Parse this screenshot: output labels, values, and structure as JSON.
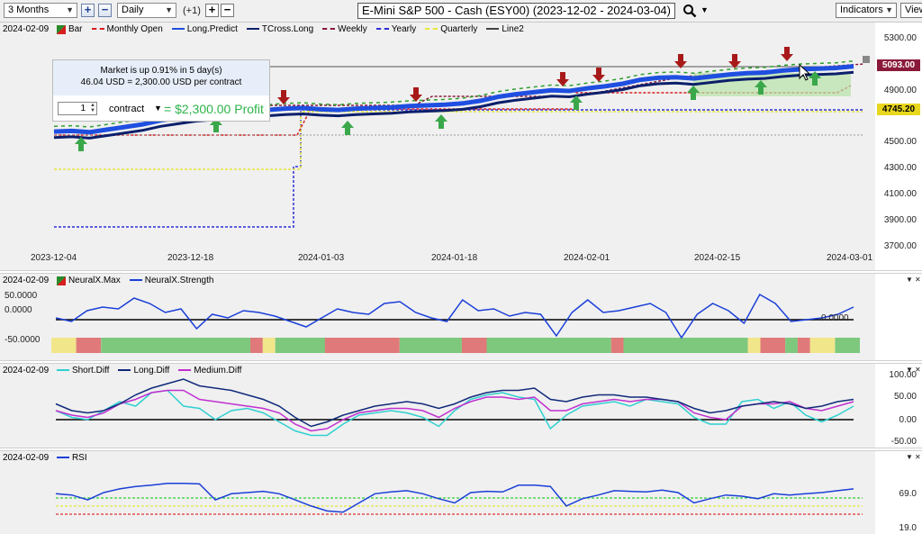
{
  "toolbar": {
    "range_value": "3 Months",
    "interval_value": "Daily",
    "offset_label": "(+1)",
    "title": "E-Mini S&P 500 - Cash (ESY00) (2023-12-02 - 2024-03-04)",
    "indicators_label": "Indicators",
    "view_label": "View"
  },
  "main": {
    "date": "2024-02-09",
    "legend": [
      {
        "label": "Bar",
        "color": "#2a8a2a",
        "style": "bar"
      },
      {
        "label": "Monthly Open",
        "color": "#d81e1e",
        "style": "dash"
      },
      {
        "label": "Long.Predict",
        "color": "#1f4fe0",
        "style": "line"
      },
      {
        "label": "TCross.Long",
        "color": "#0b1f6b",
        "style": "line"
      },
      {
        "label": "Weekly",
        "color": "#8a1a3a",
        "style": "dash"
      },
      {
        "label": "Yearly",
        "color": "#2f2fd8",
        "style": "dash"
      },
      {
        "label": "Quarterly",
        "color": "#e6e63a",
        "style": "dash"
      },
      {
        "label": "Line2",
        "color": "#444444",
        "style": "line"
      }
    ],
    "info": {
      "line1": "Market is up 0.91% in 5 day(s)",
      "line2": "46.04 USD = 2,300.00 USD per contract",
      "qty": "1",
      "contract_label": "contract",
      "profit": "= $2,300.00 Profit"
    },
    "y_ticks": [
      "5300.00",
      "4900.00",
      "4500.00",
      "4300.00",
      "4100.00",
      "3900.00",
      "3700.00"
    ],
    "badges": [
      {
        "text": "5093.00",
        "color": "#8a1a3a"
      },
      {
        "text": "4745.20",
        "color": "#e8d71e"
      }
    ],
    "x_ticks": [
      "2023-12-04",
      "2023-12-18",
      "2024-01-03",
      "2024-01-18",
      "2024-02-01",
      "2024-02-15",
      "2024-03-01"
    ],
    "price": [
      4595,
      4600,
      4590,
      4610,
      4630,
      4650,
      4680,
      4700,
      4720,
      4730,
      4740,
      4755,
      4760,
      4770,
      4775,
      4765,
      4760,
      4770,
      4775,
      4780,
      4790,
      4795,
      4800,
      4810,
      4830,
      4860,
      4880,
      4895,
      4910,
      4905,
      4925,
      4940,
      4960,
      4990,
      5005,
      5010,
      5000,
      5015,
      5030,
      5040,
      5045,
      5060,
      5070,
      5075,
      5080,
      5093
    ]
  },
  "panel_neural": {
    "date": "2024-02-09",
    "legend": [
      {
        "label": "NeuralX.Max",
        "color": "#2a8a2a",
        "style": "bar"
      },
      {
        "label": "NeuralX.Strength",
        "color": "#1a3fd8",
        "style": "line"
      }
    ],
    "y_ticks": [
      "50.0000",
      "0.0000",
      "-50.0000"
    ],
    "strength": [
      5,
      -5,
      25,
      35,
      30,
      60,
      45,
      20,
      30,
      -25,
      15,
      5,
      25,
      20,
      10,
      -5,
      -20,
      5,
      30,
      20,
      15,
      45,
      50,
      20,
      5,
      -5,
      55,
      25,
      30,
      10,
      20,
      15,
      -45,
      20,
      55,
      20,
      25,
      35,
      45,
      20,
      -50,
      15,
      45,
      25,
      -10,
      70,
      45,
      -5,
      0,
      5,
      15,
      35
    ],
    "segments": [
      {
        "w": 2,
        "c": "#f2e68a"
      },
      {
        "w": 2,
        "c": "#e07a7a"
      },
      {
        "w": 12,
        "c": "#7ec87e"
      },
      {
        "w": 1,
        "c": "#e07a7a"
      },
      {
        "w": 1,
        "c": "#f2e68a"
      },
      {
        "w": 4,
        "c": "#7ec87e"
      },
      {
        "w": 6,
        "c": "#e07a7a"
      },
      {
        "w": 5,
        "c": "#7ec87e"
      },
      {
        "w": 2,
        "c": "#e07a7a"
      },
      {
        "w": 10,
        "c": "#7ec87e"
      },
      {
        "w": 1,
        "c": "#e07a7a"
      },
      {
        "w": 10,
        "c": "#7ec87e"
      },
      {
        "w": 1,
        "c": "#f2e68a"
      },
      {
        "w": 2,
        "c": "#e07a7a"
      },
      {
        "w": 1,
        "c": "#7ec87e"
      },
      {
        "w": 1,
        "c": "#e07a7a"
      },
      {
        "w": 2,
        "c": "#f2e68a"
      },
      {
        "w": 2,
        "c": "#7ec87e"
      }
    ]
  },
  "panel_diff": {
    "date": "2024-02-09",
    "legend": [
      {
        "label": "Short.Diff",
        "color": "#30d0d0",
        "style": "line"
      },
      {
        "label": "Long.Diff",
        "color": "#102a7a",
        "style": "line"
      },
      {
        "label": "Medium.Diff",
        "color": "#c030d0",
        "style": "line"
      }
    ],
    "y_ticks": [
      "100.00",
      "50.00",
      "0.00",
      "-50.00"
    ],
    "short": [
      20,
      5,
      0,
      20,
      40,
      30,
      60,
      65,
      30,
      25,
      0,
      20,
      25,
      15,
      -5,
      -25,
      -35,
      -35,
      -10,
      10,
      15,
      20,
      15,
      5,
      -15,
      20,
      45,
      55,
      60,
      50,
      45,
      -20,
      10,
      30,
      35,
      40,
      30,
      45,
      40,
      35,
      5,
      -10,
      -10,
      40,
      45,
      25,
      40,
      10,
      -5,
      10,
      30
    ],
    "long": [
      35,
      20,
      15,
      20,
      35,
      55,
      70,
      80,
      90,
      75,
      70,
      65,
      55,
      45,
      30,
      5,
      -15,
      -5,
      10,
      20,
      30,
      35,
      40,
      35,
      25,
      35,
      50,
      60,
      65,
      65,
      70,
      45,
      40,
      50,
      55,
      55,
      50,
      50,
      45,
      40,
      25,
      15,
      20,
      30,
      35,
      40,
      35,
      25,
      30,
      40,
      45
    ],
    "medium": [
      20,
      10,
      5,
      15,
      35,
      45,
      60,
      65,
      65,
      45,
      40,
      35,
      30,
      25,
      15,
      -10,
      -25,
      -20,
      0,
      15,
      20,
      25,
      25,
      20,
      5,
      25,
      40,
      50,
      50,
      45,
      50,
      20,
      20,
      35,
      40,
      45,
      40,
      45,
      45,
      40,
      15,
      5,
      0,
      30,
      35,
      35,
      40,
      25,
      20,
      30,
      40
    ]
  },
  "panel_rsi": {
    "date": "2024-02-09",
    "legend": [
      {
        "label": "RSI",
        "color": "#1a3fd8",
        "style": "line"
      }
    ],
    "y_ticks": [
      "69.0",
      "19.0"
    ],
    "rsi": [
      70,
      68,
      60,
      72,
      78,
      82,
      84,
      87,
      87,
      86,
      60,
      70,
      72,
      74,
      70,
      60,
      50,
      42,
      40,
      55,
      70,
      73,
      75,
      70,
      62,
      55,
      72,
      74,
      73,
      84,
      84,
      82,
      50,
      62,
      68,
      75,
      74,
      73,
      76,
      72,
      55,
      62,
      68,
      66,
      62,
      70,
      68,
      70,
      72,
      75,
      78
    ]
  }
}
